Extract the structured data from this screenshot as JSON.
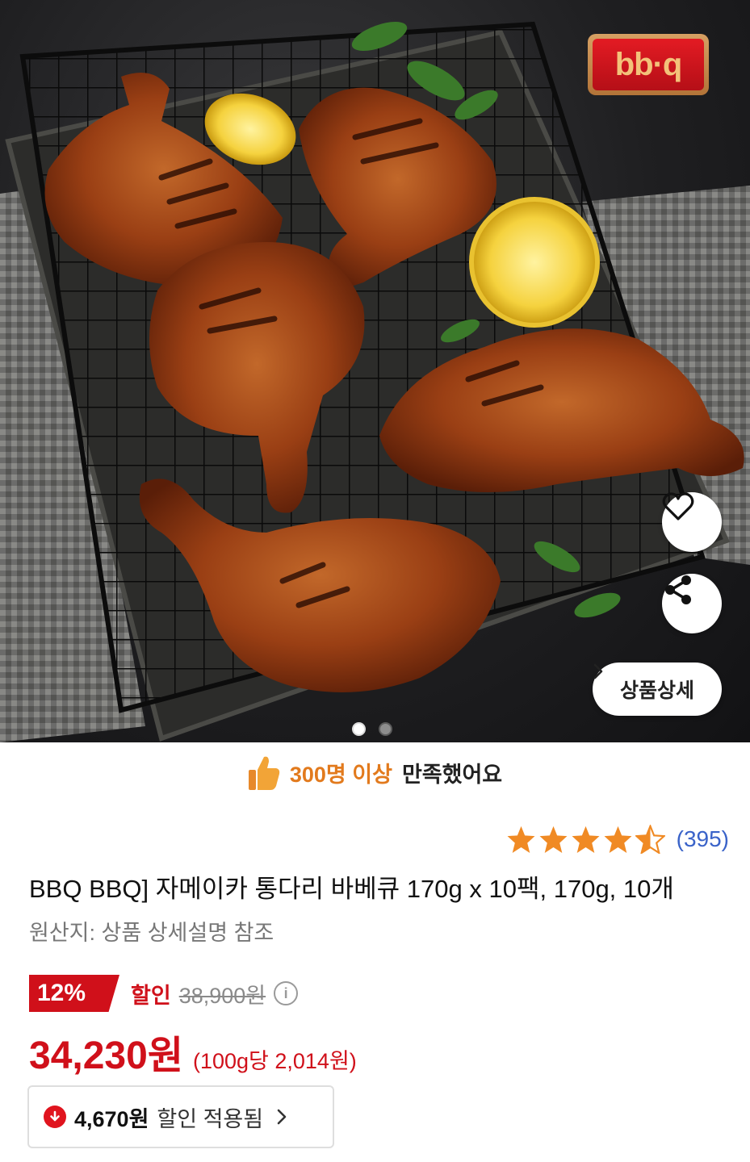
{
  "hero": {
    "logo_text": "bb·q",
    "detail_button_label": "상품상세",
    "slide_count": 2,
    "active_slide": 1,
    "icons": [
      "heart-icon",
      "share-icon",
      "chevron-right-icon"
    ]
  },
  "satisfaction": {
    "highlight": "300명 이상",
    "text": "만족했어요",
    "icon": "thumbs-up-icon"
  },
  "rating": {
    "stars": 4.5,
    "review_count": "(395)",
    "star_color": "#f08a24"
  },
  "product": {
    "title": "BBQ BBQ] 자메이카 통다리 바베큐 170g x 10팩, 170g, 10개",
    "origin": "원산지: 상품 상세설명 참조"
  },
  "pricing": {
    "discount_rate": "12%",
    "discount_label": "할인",
    "original_price": "38,900원",
    "info_icon": "i",
    "price": "34,230원",
    "unit_price": "(100g당 2,014원)",
    "accent_color": "#d0101a"
  },
  "coupon": {
    "amount": "4,670원",
    "text": "할인 적용됨",
    "icon": "down-arrow-circle-icon"
  }
}
